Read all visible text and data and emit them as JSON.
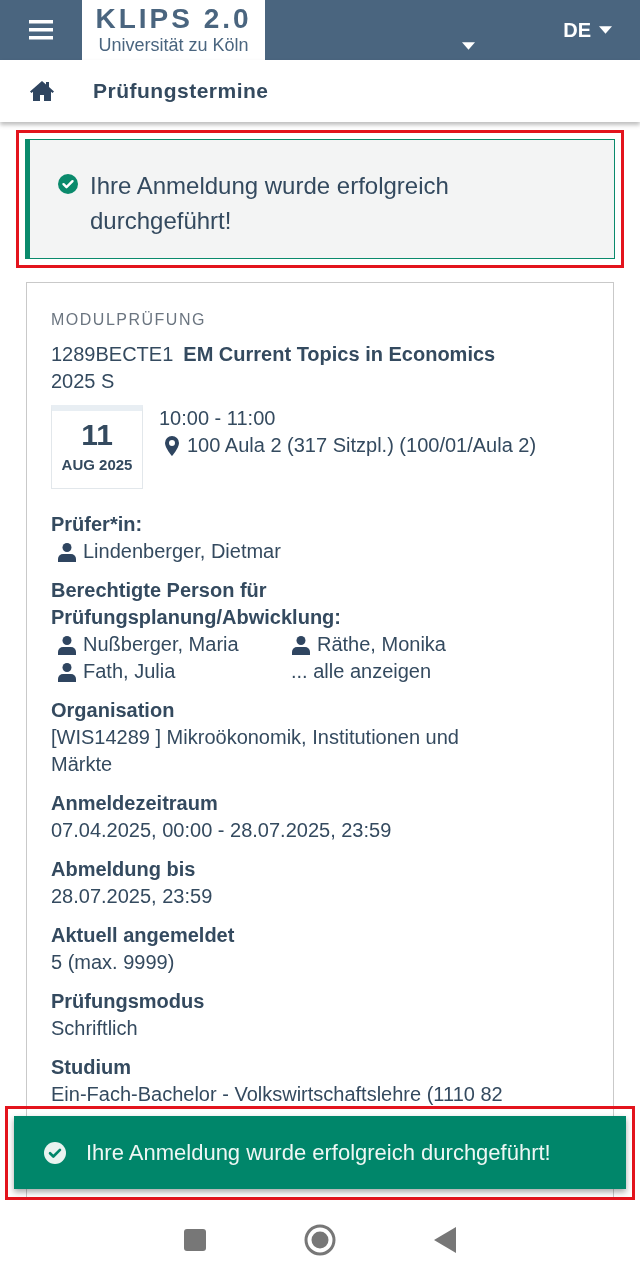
{
  "header": {
    "logo_title": "KLIPS 2.0",
    "logo_subtitle": "Universität zu Köln",
    "language": "DE"
  },
  "breadcrumb": {
    "title": "Prüfungstermine"
  },
  "alert": {
    "message": "Ihre Anmeldung wurde erfolgreich durchgeführt!"
  },
  "exam": {
    "type_label": "MODULPRÜFUNG",
    "code": "1289BECTE1",
    "title": "EM Current Topics in Economics",
    "semester": "2025 S",
    "date": {
      "day": "11",
      "month_year": "AUG 2025"
    },
    "time": "10:00 - 11:00",
    "location": "100 Aula 2 (317 Sitzpl.) (100/01/Aula 2)",
    "examiner_label": "Prüfer*in:",
    "examiners": [
      "Lindenberger, Dietmar"
    ],
    "authorized_label": "Berechtigte Person für Prüfungsplanung/Abwicklung:",
    "authorized": [
      "Nußberger, Maria",
      "Räthe, Monika",
      "Fath, Julia"
    ],
    "show_all": "... alle anzeigen",
    "fields": [
      {
        "label": "Organisation",
        "value": "[WIS14289 ] Mikroökonomik, Institutionen und Märkte"
      },
      {
        "label": "Anmeldezeitraum",
        "value": "07.04.2025, 00:00 - 28.07.2025, 23:59"
      },
      {
        "label": "Abmeldung bis",
        "value": "28.07.2025, 23:59"
      },
      {
        "label": "Aktuell angemeldet",
        "value": "5 (max. 9999)"
      },
      {
        "label": "Prüfungsmodus",
        "value": "Schriftlich"
      },
      {
        "label": "Studium",
        "value": "Ein-Fach-Bachelor - Volkswirtschaftslehre (1110 82"
      }
    ]
  },
  "toast": {
    "message": "Ihre Anmeldung wurde erfolgreich durchgeführt!"
  }
}
